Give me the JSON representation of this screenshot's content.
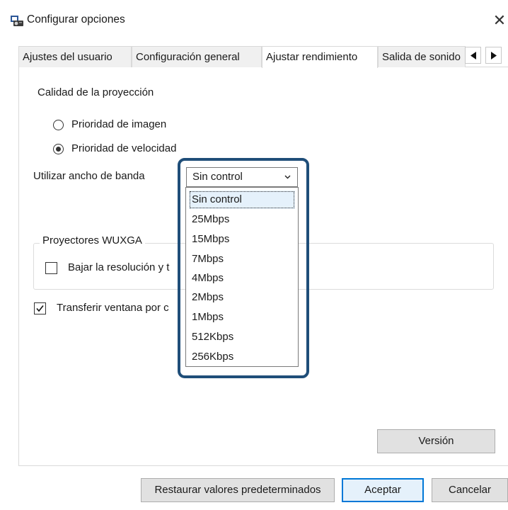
{
  "window": {
    "title": "Configurar opciones",
    "icon": "projector-app-icon",
    "close_glyph": "✕"
  },
  "tabs": [
    {
      "label": "Ajustes del usuario",
      "active": false
    },
    {
      "label": "Configuración general",
      "active": false
    },
    {
      "label": "Ajustar rendimiento",
      "active": true
    },
    {
      "label": "Salida de sonido",
      "active": false
    }
  ],
  "tab_scroll": {
    "left_icon": "triangle-left-icon",
    "right_icon": "triangle-right-icon"
  },
  "projection_quality": {
    "label": "Calidad de la proyección",
    "options": [
      {
        "label": "Prioridad de imagen",
        "checked": false
      },
      {
        "label": "Prioridad de velocidad",
        "checked": true
      }
    ]
  },
  "bandwidth": {
    "label": "Utilizar ancho de banda",
    "selected": "Sin control",
    "options": [
      "Sin control",
      "25Mbps",
      "15Mbps",
      "7Mbps",
      "4Mbps",
      "2Mbps",
      "1Mbps",
      "512Kbps",
      "256Kbps"
    ]
  },
  "wuxga_group": {
    "title": "Proyectores WUXGA",
    "checkbox_label": "Bajar la resolución y t",
    "checked": false
  },
  "transfer": {
    "label": "Transferir ventana por c",
    "checked": true
  },
  "buttons": {
    "version": "Versión",
    "restore": "Restaurar valores predeterminados",
    "accept": "Aceptar",
    "cancel": "Cancelar"
  },
  "colors": {
    "highlight": "#1f4e79",
    "primary_border": "#0078d7",
    "selected_bg": "#e5f1fb"
  }
}
